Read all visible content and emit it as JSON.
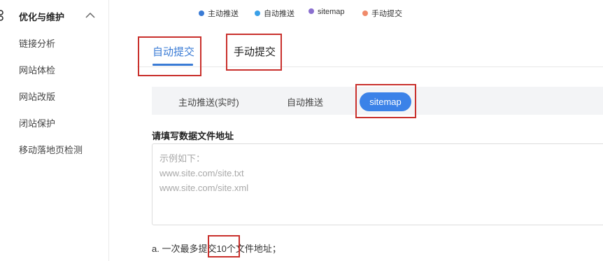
{
  "sidebar": {
    "section_label": "优化与维护",
    "items": [
      {
        "label": "链接分析"
      },
      {
        "label": "网站体检"
      },
      {
        "label": "网站改版"
      },
      {
        "label": "闭站保护"
      },
      {
        "label": "移动落地页检测"
      }
    ]
  },
  "legend": [
    {
      "label": "主动推送",
      "color": "#3a7bd5"
    },
    {
      "label": "自动推送",
      "color": "#3aa0e8"
    },
    {
      "label": "sitemap",
      "color": "#8a6fcf"
    },
    {
      "label": "手动提交",
      "color": "#f08a6a"
    }
  ],
  "tabs": [
    {
      "label": "自动提交",
      "active": true
    },
    {
      "label": "手动提交",
      "active": false
    }
  ],
  "subtabs": [
    {
      "label": "主动推送(实时)"
    },
    {
      "label": "自动推送"
    },
    {
      "label": "sitemap",
      "active": true
    }
  ],
  "form": {
    "label": "请填写数据文件地址",
    "placeholder_lines": [
      "示例如下：",
      "www.site.com/site.txt",
      "www.site.com/site.xml"
    ]
  },
  "note": "a. 一次最多提交10个文件地址；",
  "colors": {
    "accent": "#3a7bd5",
    "highlight_box": "#c9302c",
    "pill": "#3b82e8"
  }
}
